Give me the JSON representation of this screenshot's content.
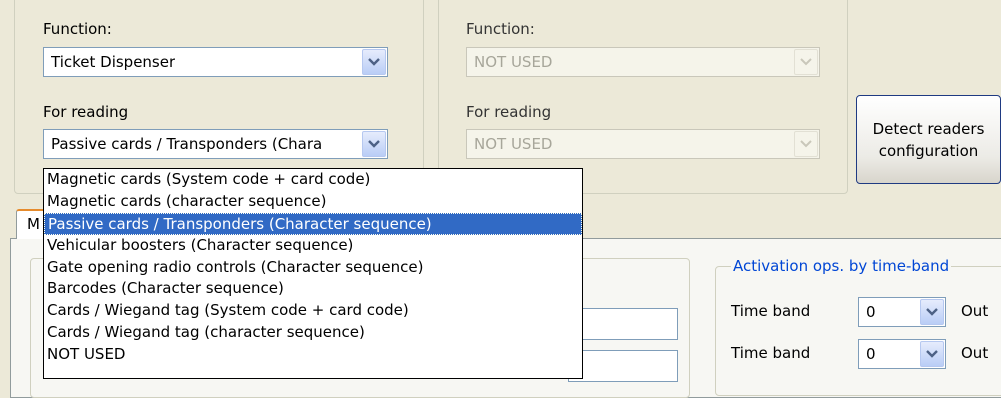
{
  "reader1": {
    "function_label": "Function:",
    "function_value": "Ticket Dispenser",
    "reading_label": "For reading",
    "reading_value": "Passive cards / Transponders (Chara"
  },
  "reader2": {
    "function_label": "Function:",
    "function_value": "NOT USED",
    "reading_label": "For reading",
    "reading_value": "NOT USED"
  },
  "detect_button": {
    "line1": "Detect readers",
    "line2": "configuration"
  },
  "tab": {
    "label": "M"
  },
  "reading_dropdown": {
    "selected_index": 2,
    "options": [
      "Magnetic cards (System code + card code)",
      "Magnetic cards (character sequence)",
      "Passive cards / Transponders (Character sequence)",
      "Vehicular boosters (Character sequence)",
      "Gate opening radio controls (Character sequence)",
      "Barcodes (Character sequence)",
      "Cards / Wiegand tag (System code + card code)",
      "Cards / Wiegand tag (character sequence)",
      "NOT USED"
    ]
  },
  "activation": {
    "legend": "Activation ops. by time-band",
    "rows": [
      {
        "label": "Time band",
        "value": "0",
        "out": "Out"
      },
      {
        "label": "Time band",
        "value": "0",
        "out": "Out"
      }
    ]
  },
  "colors": {
    "accent": "#316ac5",
    "legend": "#0046d5",
    "window_bg": "#ece9d8"
  }
}
